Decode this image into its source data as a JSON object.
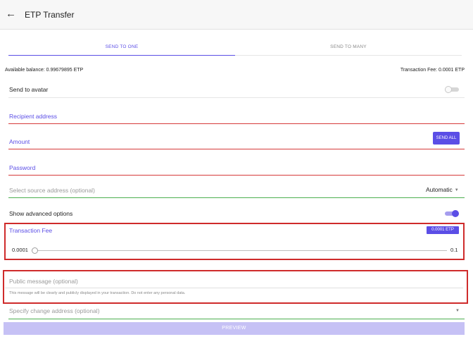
{
  "header": {
    "title": "ETP Transfer",
    "back_icon": "arrow-left-icon"
  },
  "tabs": [
    {
      "label": "SEND TO ONE",
      "active": true
    },
    {
      "label": "SEND TO MANY",
      "active": false
    }
  ],
  "balance": {
    "available": "Available balance: 0.99679895 ETP",
    "fee": "Transaction Fee: 0.0001 ETP"
  },
  "avatar": {
    "label": "Send to avatar",
    "enabled": false
  },
  "form": {
    "recipient_placeholder": "Recipient address",
    "amount_placeholder": "Amount",
    "send_all_label": "SEND ALL",
    "password_placeholder": "Password",
    "source_placeholder": "Select source address (optional)",
    "source_value": "Automatic"
  },
  "advanced": {
    "label": "Show advanced options",
    "enabled": true
  },
  "fee": {
    "label": "Transaction Fee",
    "badge": "0.0001 ETP",
    "min": "0.0001",
    "max": "0.1"
  },
  "message": {
    "placeholder": "Public message (optional)",
    "note": "This message will be clearly and publicly displayed in your transaction. Do not enter any personal data."
  },
  "change": {
    "placeholder": "Specify change address (optional)"
  },
  "preview_label": "PREVIEW",
  "colors": {
    "accent": "#5b4ee6",
    "error": "#d63a3a",
    "valid": "#4caf50",
    "highlight": "#cf2b2b"
  }
}
